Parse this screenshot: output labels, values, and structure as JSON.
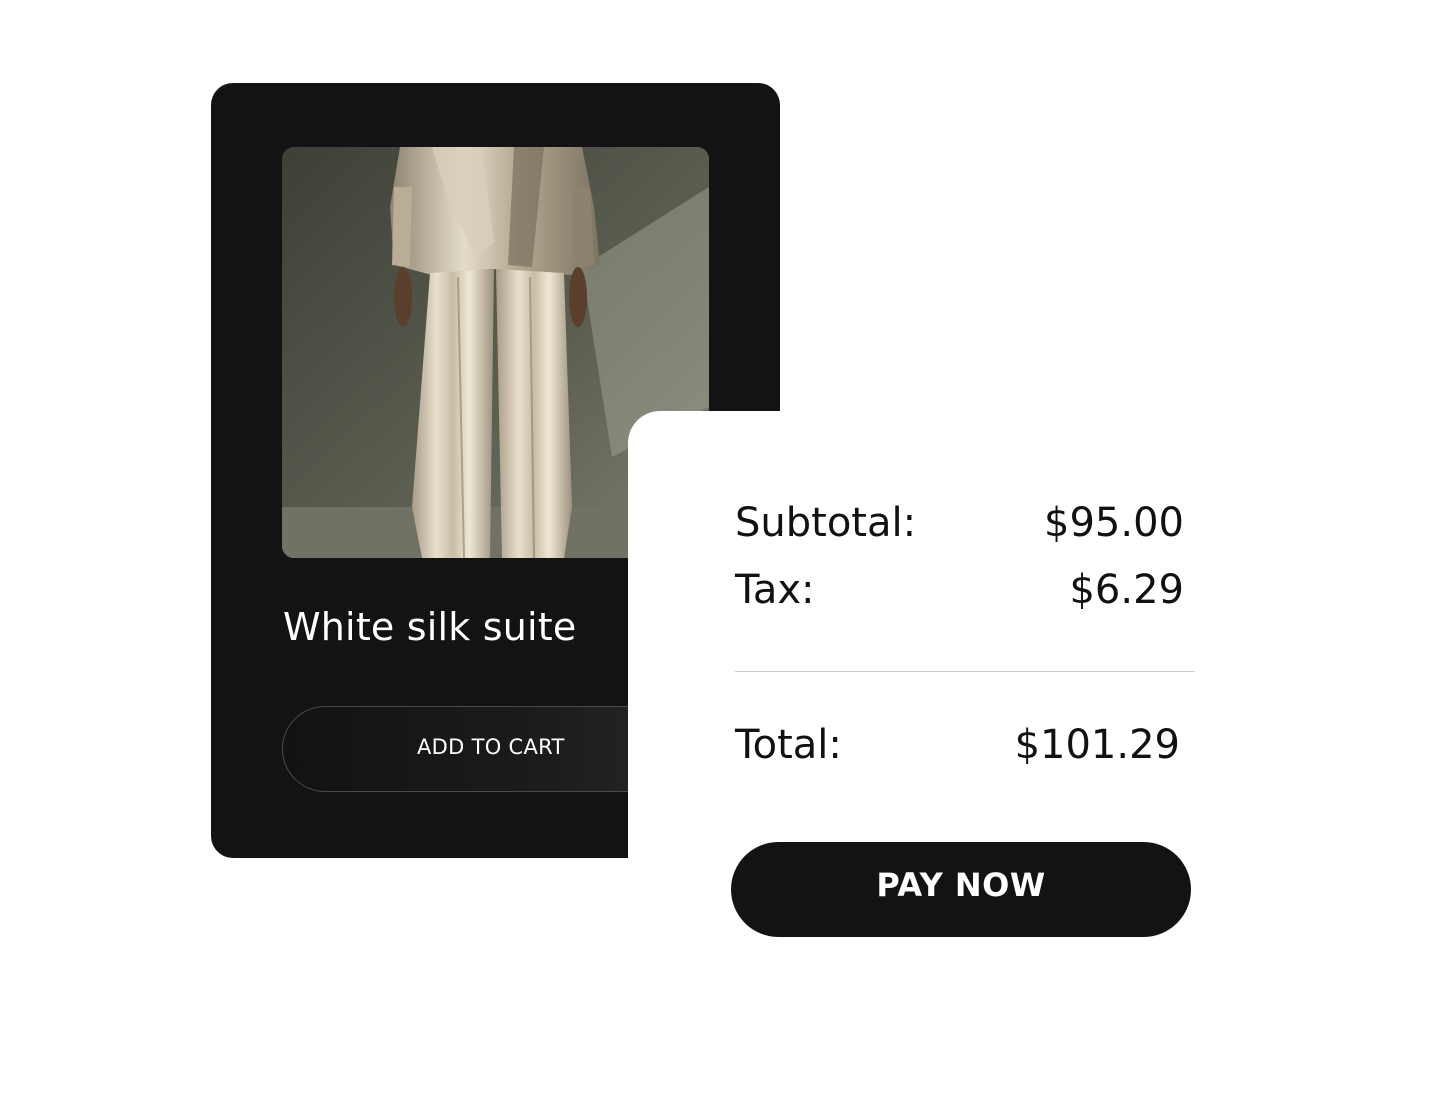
{
  "product": {
    "name": "White silk suite",
    "image_alt": "model wearing white silk suit",
    "add_to_cart_label": "ADD TO CART"
  },
  "summary": {
    "subtotal_label": "Subtotal:",
    "subtotal_value": "$95.00",
    "tax_label": "Tax:",
    "tax_value": "$6.29",
    "total_label": "Total:",
    "total_value": "$101.29",
    "pay_now_label": "PAY NOW"
  },
  "colors": {
    "card_background": "#131313",
    "panel_background": "#ffffff",
    "text_dark": "#111111",
    "text_light": "#ffffff",
    "divider": "#cfcfcf"
  }
}
